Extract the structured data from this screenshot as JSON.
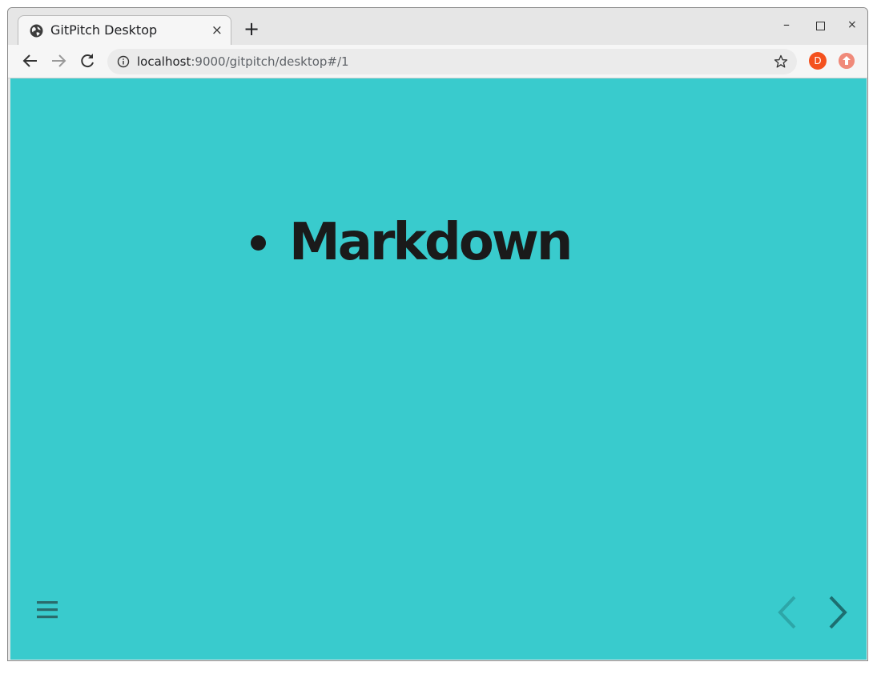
{
  "tab": {
    "title": "GitPitch Desktop",
    "close_label": "×",
    "favicon": "globe-icon"
  },
  "new_tab_label": "+",
  "window_controls": {
    "minimize": "–",
    "close": "×"
  },
  "address_bar": {
    "host": "localhost",
    "path": ":9000/gitpitch/desktop#/1"
  },
  "profile": {
    "initial": "D",
    "color": "#f4511e"
  },
  "extension": {
    "icon": "upload-icon",
    "color": "#f08a7a"
  },
  "slide": {
    "background": "#39cbcd",
    "items": [
      "Markdown"
    ]
  },
  "controls": {
    "menu_icon": "hamburger-menu-icon",
    "prev_icon": "chevron-left-icon",
    "next_icon": "chevron-right-icon"
  }
}
